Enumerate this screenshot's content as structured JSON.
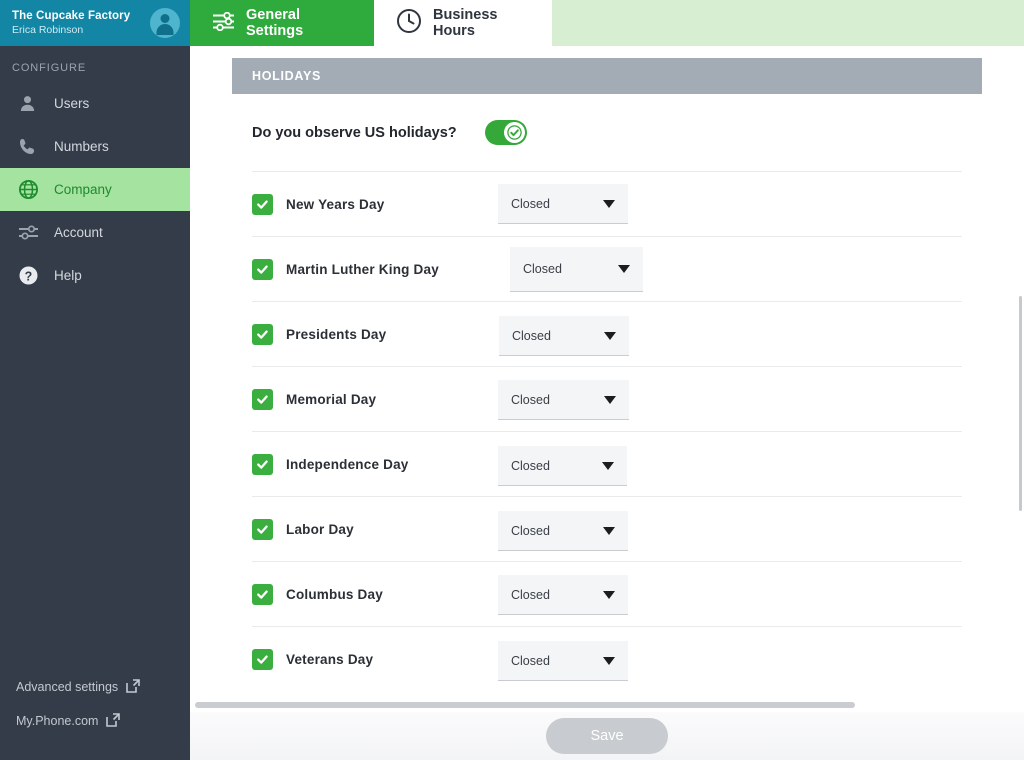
{
  "sidebar": {
    "company_name": "The Cupcake Factory",
    "user_name": "Erica Robinson",
    "section_label": "CONFIGURE",
    "items": [
      {
        "label": "Users",
        "icon": "user-icon"
      },
      {
        "label": "Numbers",
        "icon": "phone-icon"
      },
      {
        "label": "Company",
        "icon": "globe-icon"
      },
      {
        "label": "Account",
        "icon": "sliders-icon"
      },
      {
        "label": "Help",
        "icon": "question-circle-icon"
      }
    ],
    "bottom_links": [
      {
        "label": "Advanced settings",
        "icon": "external-link-icon"
      },
      {
        "label": "My.Phone.com",
        "icon": "external-link-icon"
      }
    ]
  },
  "tabs": [
    {
      "label": "General Settings",
      "icon": "sliders-icon",
      "active": true
    },
    {
      "label": "Business Hours",
      "icon": "clock-icon",
      "active": false
    }
  ],
  "main": {
    "section_title": "HOLIDAYS",
    "observe_question": "Do you observe US holidays?",
    "observe_enabled": true,
    "holidays": [
      {
        "name": "New Years Day",
        "checked": true,
        "status": "Closed"
      },
      {
        "name": "Martin Luther King Day",
        "checked": true,
        "status": "Closed"
      },
      {
        "name": "Presidents Day",
        "checked": true,
        "status": "Closed"
      },
      {
        "name": "Memorial Day",
        "checked": true,
        "status": "Closed"
      },
      {
        "name": "Independence Day",
        "checked": true,
        "status": "Closed"
      },
      {
        "name": "Labor Day",
        "checked": true,
        "status": "Closed"
      },
      {
        "name": "Columbus Day",
        "checked": true,
        "status": "Closed"
      },
      {
        "name": "Veterans Day",
        "checked": true,
        "status": "Closed"
      }
    ]
  },
  "footer": {
    "save_label": "Save",
    "save_disabled": true
  },
  "colors": {
    "brand_green": "#2faa3c",
    "teal_header": "#1286a4",
    "sidebar_bg": "#353c49",
    "active_nav_bg": "#a5e3a0",
    "section_bar": "#a3abb4",
    "tab_strip_bg": "#d7eed2"
  }
}
